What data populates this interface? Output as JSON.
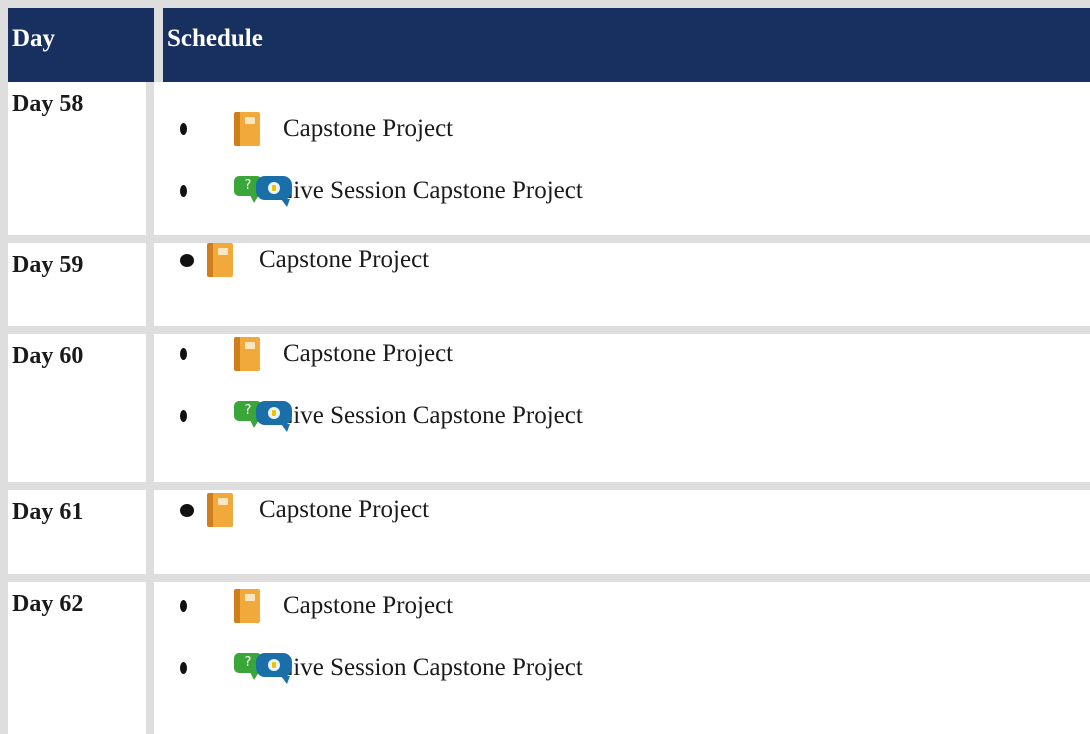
{
  "header": {
    "day_label": "Day",
    "schedule_label": "Schedule"
  },
  "rows": [
    {
      "day": "Day 58",
      "items": [
        {
          "icon": "book-icon",
          "label": "Capstone Project"
        },
        {
          "icon": "live-session-icon",
          "label": "Live Session Capstone Project"
        }
      ]
    },
    {
      "day": "Day 59",
      "items": [
        {
          "icon": "book-icon",
          "label": "Capstone Project"
        }
      ]
    },
    {
      "day": "Day 60",
      "items": [
        {
          "icon": "book-icon",
          "label": "Capstone Project"
        },
        {
          "icon": "live-session-icon",
          "label": "Live Session Capstone Project"
        }
      ]
    },
    {
      "day": "Day 61",
      "items": [
        {
          "icon": "book-icon",
          "label": "Capstone Project"
        }
      ]
    },
    {
      "day": "Day 62",
      "items": [
        {
          "icon": "book-icon",
          "label": "Capstone Project"
        },
        {
          "icon": "live-session-icon",
          "label": "Live Session Capstone Project"
        }
      ]
    }
  ],
  "colors": {
    "header_background": "#17305f",
    "header_text": "#ffffff",
    "border": "#dedede",
    "book_icon": "#f2a93b",
    "question_bubble": "#3aa63a",
    "idea_bubble": "#1b6fa8"
  }
}
